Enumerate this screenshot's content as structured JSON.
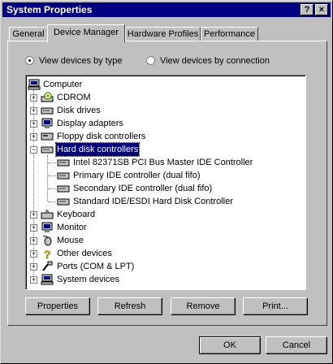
{
  "window": {
    "title": "System Properties",
    "help_glyph": "?",
    "close_glyph": "×"
  },
  "tabs": [
    {
      "label": "General"
    },
    {
      "label": "Device Manager"
    },
    {
      "label": "Hardware Profiles"
    },
    {
      "label": "Performance"
    }
  ],
  "view": {
    "by_type_label": "View devices by type",
    "by_connection_label": "View devices by connection",
    "selected": "by_type"
  },
  "tree": {
    "root": "Computer",
    "categories": [
      {
        "label": "CDROM",
        "icon": "cdrom-icon"
      },
      {
        "label": "Disk drives",
        "icon": "disk-drive-icon"
      },
      {
        "label": "Display adapters",
        "icon": "display-adapter-icon"
      },
      {
        "label": "Floppy disk controllers",
        "icon": "floppy-controller-icon"
      },
      {
        "label": "Hard disk controllers",
        "icon": "hard-disk-controller-icon",
        "expanded": true,
        "selected": true,
        "children": [
          "Intel 82371SB PCI Bus Master IDE Controller",
          "Primary IDE controller (dual fifo)",
          "Secondary IDE controller (dual fifo)",
          "Standard IDE/ESDI Hard Disk Controller"
        ]
      },
      {
        "label": "Keyboard",
        "icon": "keyboard-icon"
      },
      {
        "label": "Monitor",
        "icon": "monitor-icon"
      },
      {
        "label": "Mouse",
        "icon": "mouse-icon"
      },
      {
        "label": "Other devices",
        "icon": "question-icon"
      },
      {
        "label": "Ports (COM & LPT)",
        "icon": "port-icon"
      },
      {
        "label": "System devices",
        "icon": "system-devices-icon"
      }
    ]
  },
  "buttons": {
    "properties": "Properties",
    "refresh": "Refresh",
    "remove": "Remove",
    "print": "Print...",
    "ok": "OK",
    "cancel": "Cancel"
  }
}
